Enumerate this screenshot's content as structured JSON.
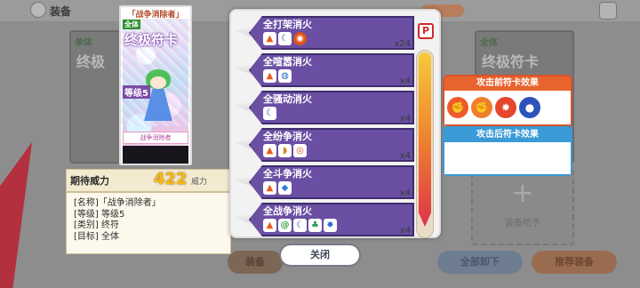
{
  "background": {
    "title": "装备",
    "slot_label": "装备给予",
    "buttons": {
      "equip": "装备",
      "unload_all": "全部卸下",
      "recommend": "推荐装备"
    },
    "card_tags": [
      "单体",
      "全体"
    ],
    "card_texts": [
      "终极",
      "终极符卡"
    ]
  },
  "card": {
    "name": "「战争消除者」",
    "scope": "全体",
    "title": "终极符卡",
    "level": "等级5",
    "strip_text": "战争消除者"
  },
  "expected_power": {
    "label": "期待威力",
    "value": "422",
    "unit": "威力"
  },
  "info": {
    "lines": [
      "[名称]「战争消除者」",
      "[等级] 等级5",
      "[类别] 终符",
      "[目标] 全体"
    ]
  },
  "spells": [
    {
      "name": "全打架消火",
      "count": "x24",
      "icons": [
        "flame-icon",
        "moon-icon",
        "coin-icon"
      ]
    },
    {
      "name": "全喧嚣消火",
      "count": "x4",
      "icons": [
        "flame-icon",
        "globe-icon"
      ]
    },
    {
      "name": "全骚动消火",
      "count": "x4",
      "icons": [
        "moon-icon"
      ]
    },
    {
      "name": "全纷争消火",
      "count": "x4",
      "icons": [
        "flame-icon",
        "shield-icon",
        "target-icon"
      ]
    },
    {
      "name": "全斗争消火",
      "count": "x4",
      "icons": [
        "flame-icon",
        "diamond-icon"
      ]
    },
    {
      "name": "全战争消火",
      "count": "x4",
      "icons": [
        "flame-icon",
        "swirl-icon",
        "moon-icon",
        "leaf-icon",
        "star-icon"
      ]
    }
  ],
  "scroll_badge": "P",
  "effects": {
    "before": {
      "title": "攻击前符卡效果",
      "icons": [
        "fist-icon",
        "fist-icon",
        "burst-icon",
        "orb-icon"
      ]
    },
    "after": {
      "title": "攻击后符卡效果",
      "icons": []
    }
  },
  "close_button": "关闭",
  "colors": {
    "spell_bar": "#6a4fa3",
    "before_header": "#e8632e",
    "after_header": "#3a9ad6",
    "power_value": "#f6b811"
  }
}
